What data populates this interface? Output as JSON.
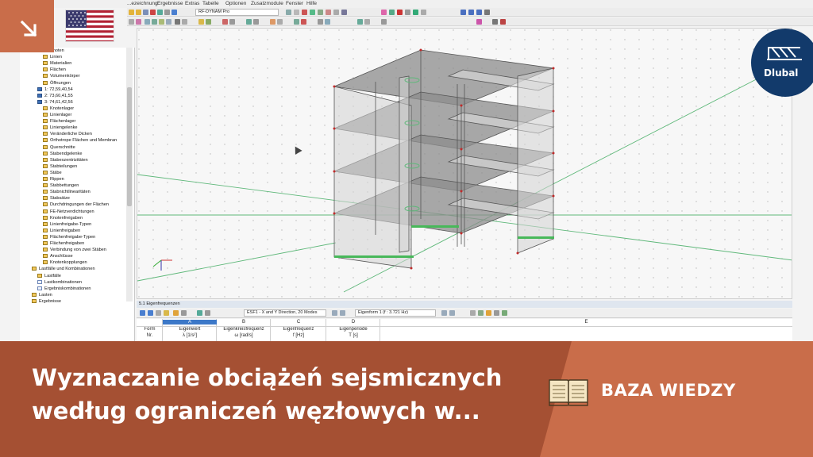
{
  "menubar": {
    "items": [
      "...ezeichnung",
      "Ergebnisse",
      "Extras",
      "Tabelle",
      "Optionen",
      "Zusatzmodule",
      "Fenster",
      "Hilfe"
    ]
  },
  "toolbar": {
    "module_combo": "RF-DYNAM Pro"
  },
  "navigator": {
    "items": [
      {
        "label": "Knoten",
        "icon": "folder"
      },
      {
        "label": "Linien",
        "icon": "folder"
      },
      {
        "label": "Materialien",
        "icon": "folder"
      },
      {
        "label": "Flächen",
        "icon": "folder"
      },
      {
        "label": "Volumenkörper",
        "icon": "folder"
      },
      {
        "label": "Öffnungen",
        "icon": "folder"
      },
      {
        "label": "1: 72,59,40,54",
        "icon": "blue"
      },
      {
        "label": "2: 73,60,41,55",
        "icon": "blue"
      },
      {
        "label": "3: 74,61,42,56",
        "icon": "blue"
      },
      {
        "label": "Knotenlager",
        "icon": "folder"
      },
      {
        "label": "Linienlager",
        "icon": "folder"
      },
      {
        "label": "Flächenlager",
        "icon": "folder"
      },
      {
        "label": "Liniengelenke",
        "icon": "folder"
      },
      {
        "label": "Veränderliche Dicken",
        "icon": "folder"
      },
      {
        "label": "Orthotrope Flächen und Membran",
        "icon": "folder"
      },
      {
        "label": "Querschnitte",
        "icon": "folder"
      },
      {
        "label": "Stabendgelenke",
        "icon": "folder"
      },
      {
        "label": "Stabexzentrizitäten",
        "icon": "folder"
      },
      {
        "label": "Stabteilungen",
        "icon": "folder"
      },
      {
        "label": "Stäbe",
        "icon": "folder"
      },
      {
        "label": "Rippen",
        "icon": "folder"
      },
      {
        "label": "Stabbettungen",
        "icon": "folder"
      },
      {
        "label": "Stabnichtlinearitäten",
        "icon": "folder"
      },
      {
        "label": "Stabsätze",
        "icon": "folder"
      },
      {
        "label": "Durchdringungen der Flächen",
        "icon": "folder"
      },
      {
        "label": "FE-Netzverdichtungen",
        "icon": "folder"
      },
      {
        "label": "Knotenfreigaben",
        "icon": "folder"
      },
      {
        "label": "Linienfreigabe-Typen",
        "icon": "folder"
      },
      {
        "label": "Linienfreigaben",
        "icon": "folder"
      },
      {
        "label": "Flächenfreigabe-Typen",
        "icon": "folder"
      },
      {
        "label": "Flächenfreigaben",
        "icon": "folder"
      },
      {
        "label": "Verbindung von zwei Stäben",
        "icon": "folder"
      },
      {
        "label": "Anschlüsse",
        "icon": "folder"
      },
      {
        "label": "Knotenkopplungen",
        "icon": "folder"
      },
      {
        "label": "Lastfälle und Kombinationen",
        "icon": "folder"
      },
      {
        "label": "Lastfälle",
        "icon": "folder"
      },
      {
        "label": "Lastkombinationen",
        "icon": "doc"
      },
      {
        "label": "Ergebniskombinationen",
        "icon": "doc"
      },
      {
        "label": "Lasten",
        "icon": "folder"
      },
      {
        "label": "Ergebnisse",
        "icon": "folder"
      }
    ]
  },
  "results_panel": {
    "title": "5.1 Eigenfrequenzen",
    "case_combo": "ESF1 - X and Y Direction, 20 Modes",
    "mode_combo": "Eigenform 1 (f : 3.721 Hz)",
    "columns": [
      {
        "letter": "A",
        "line1": "Eigenwert",
        "line2": "λ [1/s²]"
      },
      {
        "letter": "B",
        "line1": "Eigenkreisfrequenz",
        "line2": "ω [rad/s]"
      },
      {
        "letter": "C",
        "line1": "Eigenfrequenz",
        "line2": "f [Hz]"
      },
      {
        "letter": "D",
        "line1": "Eigenperiode",
        "line2": "T [s]"
      },
      {
        "letter": "E",
        "line1": "",
        "line2": ""
      }
    ],
    "row_header_line1": "Form",
    "row_header_line2": "Nr."
  },
  "branding": {
    "logo_text": "Dlubal",
    "flag": "us-flag",
    "accent_color": "#a55033",
    "corner_color": "#c96d4a"
  },
  "banner": {
    "title": "Wyznaczanie obciążeń sejsmicznych według ograniczeń węzłowych w...",
    "category": "BAZA WIEDZY"
  }
}
